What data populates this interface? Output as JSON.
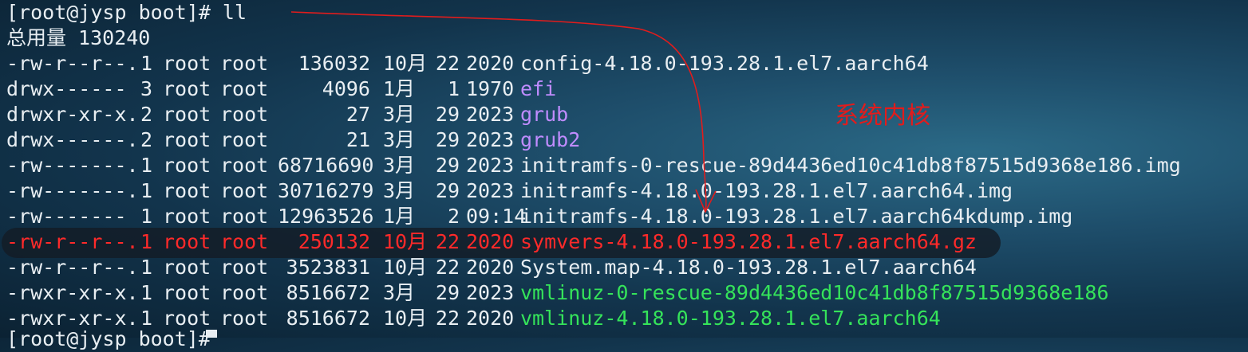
{
  "terminal": {
    "prompt": "[root@jysp boot]# ll",
    "total": "总用量 130240",
    "partial_prompt": "[root@jysp boot]#",
    "rows": [
      {
        "perm": "-rw-r--r--.",
        "links": "1",
        "owner": "root",
        "group": "root",
        "size": "136032",
        "month": "10月",
        "day": "22",
        "time": "2020",
        "name": "config-4.18.0-193.28.1.el7.aarch64",
        "type": "file"
      },
      {
        "perm": "drwx------",
        "links": "3",
        "owner": "root",
        "group": "root",
        "size": "4096",
        "month": "1月",
        "day": "1",
        "time": "1970",
        "name": "efi",
        "type": "dir"
      },
      {
        "perm": "drwxr-xr-x.",
        "links": "2",
        "owner": "root",
        "group": "root",
        "size": "27",
        "month": "3月",
        "day": "29",
        "time": "2023",
        "name": "grub",
        "type": "dir"
      },
      {
        "perm": "drwx------.",
        "links": "2",
        "owner": "root",
        "group": "root",
        "size": "21",
        "month": "3月",
        "day": "29",
        "time": "2023",
        "name": "grub2",
        "type": "dir"
      },
      {
        "perm": "-rw-------.",
        "links": "1",
        "owner": "root",
        "group": "root",
        "size": "68716690",
        "month": "3月",
        "day": "29",
        "time": "2023",
        "name": "initramfs-0-rescue-89d4436ed10c41db8f87515d9368e186.img",
        "type": "file"
      },
      {
        "perm": "-rw-------.",
        "links": "1",
        "owner": "root",
        "group": "root",
        "size": "30716279",
        "month": "3月",
        "day": "29",
        "time": "2023",
        "name": "initramfs-4.18.0-193.28.1.el7.aarch64.img",
        "type": "file"
      },
      {
        "perm": "-rw-------",
        "links": "1",
        "owner": "root",
        "group": "root",
        "size": "12963526",
        "month": "1月",
        "day": "2",
        "time": "09:14",
        "name": "initramfs-4.18.0-193.28.1.el7.aarch64kdump.img",
        "type": "file"
      },
      {
        "perm": "-rw-r--r--.",
        "links": "1",
        "owner": "root",
        "group": "root",
        "size": "250132",
        "month": "10月",
        "day": "22",
        "time": "2020",
        "name": "symvers-4.18.0-193.28.1.el7.aarch64.gz",
        "type": "highlight"
      },
      {
        "perm": "-rw-r--r--.",
        "links": "1",
        "owner": "root",
        "group": "root",
        "size": "3523831",
        "month": "10月",
        "day": "22",
        "time": "2020",
        "name": "System.map-4.18.0-193.28.1.el7.aarch64",
        "type": "file"
      },
      {
        "perm": "-rwxr-xr-x.",
        "links": "1",
        "owner": "root",
        "group": "root",
        "size": "8516672",
        "month": "3月",
        "day": "29",
        "time": "2023",
        "name": "vmlinuz-0-rescue-89d4436ed10c41db8f87515d9368e186",
        "type": "exec"
      },
      {
        "perm": "-rwxr-xr-x.",
        "links": "1",
        "owner": "root",
        "group": "root",
        "size": "8516672",
        "month": "10月",
        "day": "22",
        "time": "2020",
        "name": "vmlinuz-4.18.0-193.28.1.el7.aarch64",
        "type": "exec"
      }
    ]
  },
  "annotation": {
    "label": "系统内核",
    "color": "#e21c1c"
  },
  "colors": {
    "directory": "#c08cff",
    "executable": "#35e35a",
    "highlight": "#ff2a2a"
  }
}
